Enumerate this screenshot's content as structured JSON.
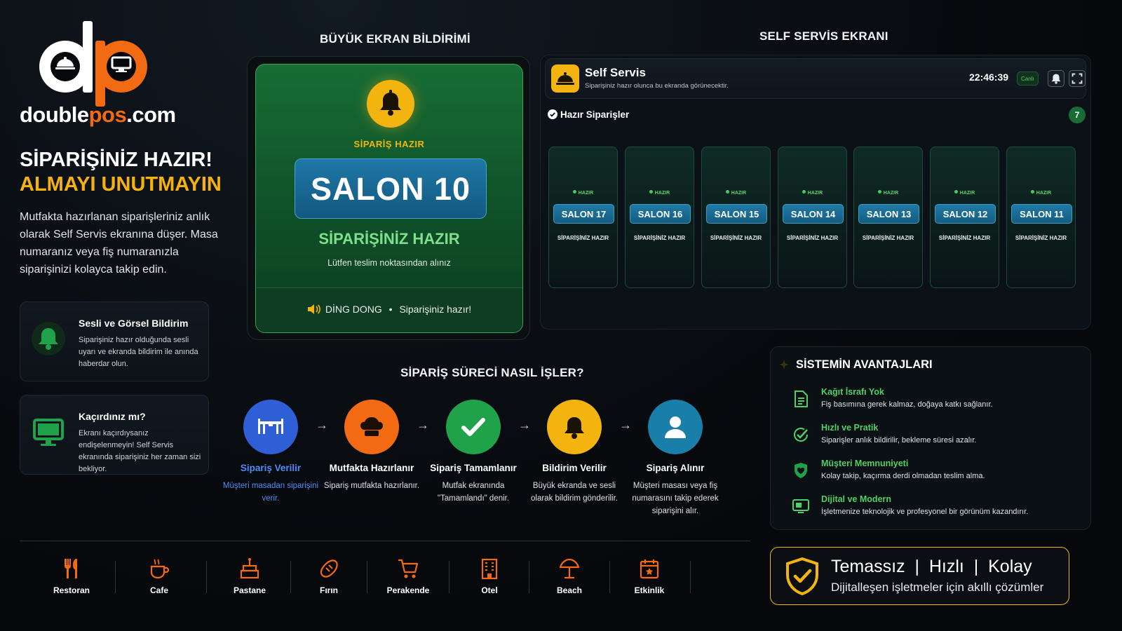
{
  "brand": {
    "name_part1": "double",
    "name_part2": "pos",
    "name_part3": ".com"
  },
  "hero": {
    "line1": "SİPARİŞİNİZ HAZIR!",
    "line2": "ALMAYI UNUTMAYIN",
    "intro": "Mutfakta hazırlanan siparişleriniz anlık olarak Self Servis ekranına düşer. Masa numaranız veya fiş numaranızla siparişinizi kolayca takip edin."
  },
  "info_cards": [
    {
      "title": "Sesli ve Görsel Bildirim",
      "desc": "Siparişiniz hazır olduğunda sesli uyarı ve ekranda bildirim ile anında haberdar olun.",
      "icon": "bell-icon"
    },
    {
      "title": "Kaçırdınız mı?",
      "desc": "Ekranı kaçırdıysanız endişelenmeyin! Self Servis ekranında siparişiniz her zaman sizi bekliyor.",
      "icon": "monitor-icon"
    }
  ],
  "big_screen": {
    "section_title": "BÜYÜK EKRAN BİLDİRİMİ",
    "kicker": "SİPARİŞ HAZIR",
    "salon": "SALON 10",
    "status": "SİPARİŞİNİZ HAZIR",
    "sub": "Lütfen teslim noktasından alınız",
    "sound": "DİNG DONG",
    "sound_sep": "•",
    "sound_msg": "Siparişiniz hazır!"
  },
  "self_service": {
    "section_title": "SELF SERVİS EKRANI",
    "title": "Self Servis",
    "subtitle": "Siparişiniz hazır olunca bu ekranda görünecektir.",
    "clock": "22:46:39",
    "live": "Canlı",
    "ready_label": "Hazır Siparişler",
    "ready_count": "7",
    "orders": [
      {
        "tag": "HAZIR",
        "salon": "SALON 17",
        "status": "SİPARİŞİNİZ HAZIR"
      },
      {
        "tag": "HAZIR",
        "salon": "SALON 16",
        "status": "SİPARİŞİNİZ HAZIR"
      },
      {
        "tag": "HAZIR",
        "salon": "SALON 15",
        "status": "SİPARİŞİNİZ HAZIR"
      },
      {
        "tag": "HAZIR",
        "salon": "SALON 14",
        "status": "SİPARİŞİNİZ HAZIR"
      },
      {
        "tag": "HAZIR",
        "salon": "SALON 13",
        "status": "SİPARİŞİNİZ HAZIR"
      },
      {
        "tag": "HAZIR",
        "salon": "SALON 12",
        "status": "SİPARİŞİNİZ HAZIR"
      },
      {
        "tag": "HAZIR",
        "salon": "SALON 11",
        "status": "SİPARİŞİNİZ HAZIR"
      }
    ]
  },
  "process": {
    "title": "SİPARİŞ SÜRECİ NASIL İŞLER?",
    "arrow": "→",
    "steps": [
      {
        "name": "Sipariş Verilir",
        "desc": "Müşteri masadan siparişini verir.",
        "color": "#2f5fd6",
        "icon": "table-icon"
      },
      {
        "name": "Mutfakta Hazırlanır",
        "desc": "Sipariş mutfakta hazırlanır.",
        "color": "#f26a12",
        "icon": "chef-hat-icon"
      },
      {
        "name": "Sipariş Tamamlanır",
        "desc": "Mutfak ekranında \"Tamamlandı\" denir.",
        "color": "#1fa24a",
        "icon": "check-icon"
      },
      {
        "name": "Bildirim Verilir",
        "desc": "Büyük ekranda ve sesli olarak bildirim gönderilir.",
        "color": "#f4b40f",
        "icon": "bell-icon"
      },
      {
        "name": "Sipariş Alınır",
        "desc": "Müşteri masası veya fiş numarasını takip ederek siparişini alır.",
        "color": "#1a7fa8",
        "icon": "user-icon"
      }
    ]
  },
  "advantages": {
    "title": "SİSTEMİN AVANTAJLARI",
    "items": [
      {
        "title": "Kağıt İsrafı Yok",
        "desc": "Fiş basımına gerek kalmaz, doğaya katkı sağlanır.",
        "icon": "document-icon"
      },
      {
        "title": "Hızlı ve Pratik",
        "desc": "Siparişler anlık bildirilir, bekleme süresi azalır.",
        "icon": "check-badge-icon"
      },
      {
        "title": "Müşteri Memnuniyeti",
        "desc": "Kolay takip, kaçırma derdi olmadan teslim alma.",
        "icon": "heart-shield-icon"
      },
      {
        "title": "Dijital ve Modern",
        "desc": "İşletmenize teknolojik ve profesyonel bir görünüm kazandırır.",
        "icon": "screen-icon"
      }
    ]
  },
  "sectors": [
    {
      "label": "Restoran",
      "icon": "fork-knife-icon"
    },
    {
      "label": "Cafe",
      "icon": "coffee-icon"
    },
    {
      "label": "Pastane",
      "icon": "cake-icon"
    },
    {
      "label": "Fırın",
      "icon": "bread-icon"
    },
    {
      "label": "Perakende",
      "icon": "cart-icon"
    },
    {
      "label": "Otel",
      "icon": "hotel-icon"
    },
    {
      "label": "Beach",
      "icon": "umbrella-icon"
    },
    {
      "label": "Etkinlik",
      "icon": "calendar-star-icon"
    }
  ],
  "tagline": {
    "line1": "Temassız  |  Hızlı  |  Kolay",
    "line2": "Dijitalleşen işletmeler için akıllı çözümler"
  },
  "colors": {
    "accent_orange": "#f26a12",
    "accent_yellow": "#f4b40f",
    "accent_green": "#4fd066",
    "salon_blue": "#1f78a8"
  }
}
